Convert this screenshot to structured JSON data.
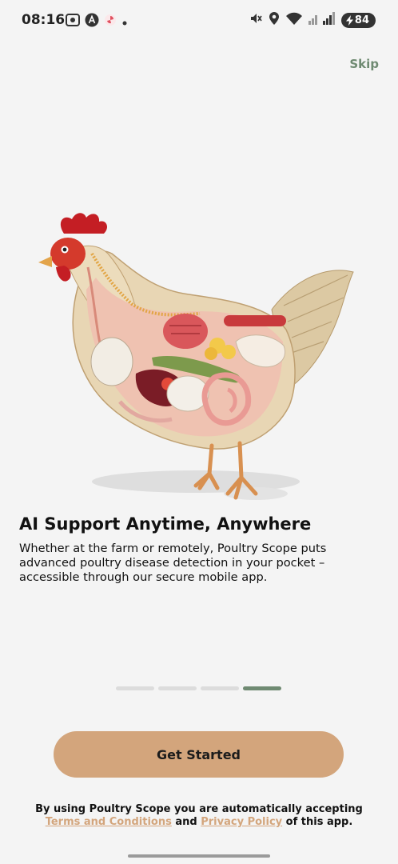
{
  "status_bar": {
    "time": "08:16",
    "battery": "84"
  },
  "onboarding": {
    "skip_label": "Skip",
    "headline": "AI Support Anytime, Anywhere",
    "description": "Whether at the farm or remotely, Poultry Scope puts advanced poultry disease detection in your pocket – accessible through our secure mobile app.",
    "page_indicator": {
      "total": 4,
      "current": 4
    },
    "cta_label": "Get Started"
  },
  "legal": {
    "prefix": "By using Poultry Scope you are automatically accepting",
    "terms_link": "Terms and Conditions",
    "and_text": "and",
    "privacy_link": "Privacy Policy",
    "suffix": "of this app."
  },
  "colors": {
    "accent_green": "#6f8a72",
    "accent_tan": "#d3a57c",
    "background": "#f4f4f4"
  },
  "icons": [
    "screen-record-icon",
    "a-badge-icon",
    "pinwheel-icon",
    "mute-icon",
    "location-pin-icon",
    "wifi-icon",
    "cell-signal-icon",
    "battery-charging-icon"
  ]
}
